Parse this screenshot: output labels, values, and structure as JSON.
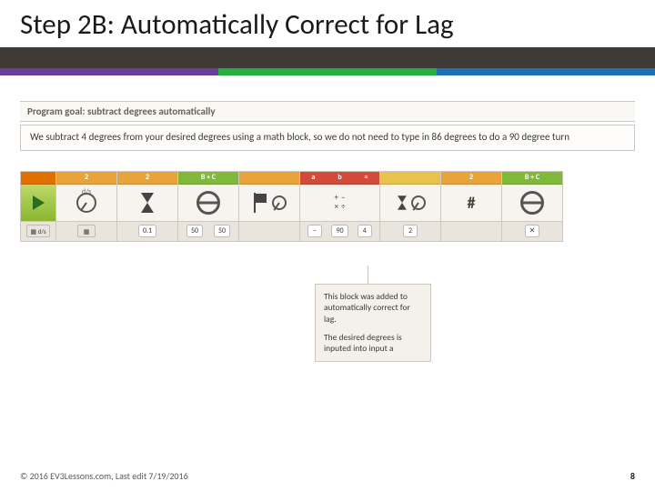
{
  "title": "Step 2B: Automatically Correct for Lag",
  "program_goal": "Program goal: subtract degrees automatically",
  "explain": "We subtract 4 degrees from your desired degrees using a math block, so we do not need to type in 86 degrees to do a 90 degree turn",
  "blocks": [
    {
      "tab_color": "orange",
      "tab_label": "",
      "type": "start"
    },
    {
      "tab_color": "orange",
      "tab_label": "2",
      "type": "gyro-reset",
      "body_label": "d/s",
      "params": []
    },
    {
      "tab_color": "orange",
      "tab_label": "2",
      "type": "hourglass",
      "params": [
        "0.1"
      ]
    },
    {
      "tab_color": "green",
      "tab_label": "B + C",
      "type": "steer",
      "params": [
        "50",
        "50"
      ]
    },
    {
      "tab_color": "orange",
      "tab_label": "",
      "type": "wait-flag",
      "params": []
    },
    {
      "tab_color": "red",
      "tab_label": "",
      "type": "math",
      "body_text": [
        "+",
        "−",
        "×",
        "÷"
      ],
      "params": [
        "−",
        "90",
        "4"
      ],
      "header": [
        "a",
        "b",
        "="
      ]
    },
    {
      "tab_color": "yellow",
      "tab_label": "",
      "type": "gyro-sensor",
      "params": [
        "2"
      ]
    },
    {
      "tab_color": "orange",
      "tab_label": "2",
      "type": "hash",
      "params": []
    },
    {
      "tab_color": "green",
      "tab_label": "B + C",
      "type": "stop",
      "params": [
        "✕"
      ]
    }
  ],
  "callout": {
    "p1": "This block was added to automatically correct for lag.",
    "p2": "The desired degrees is inputed into input a"
  },
  "footer_left": "© 2016 EV3Lessons.com, Last edit 7/19/2016",
  "footer_right": "8"
}
